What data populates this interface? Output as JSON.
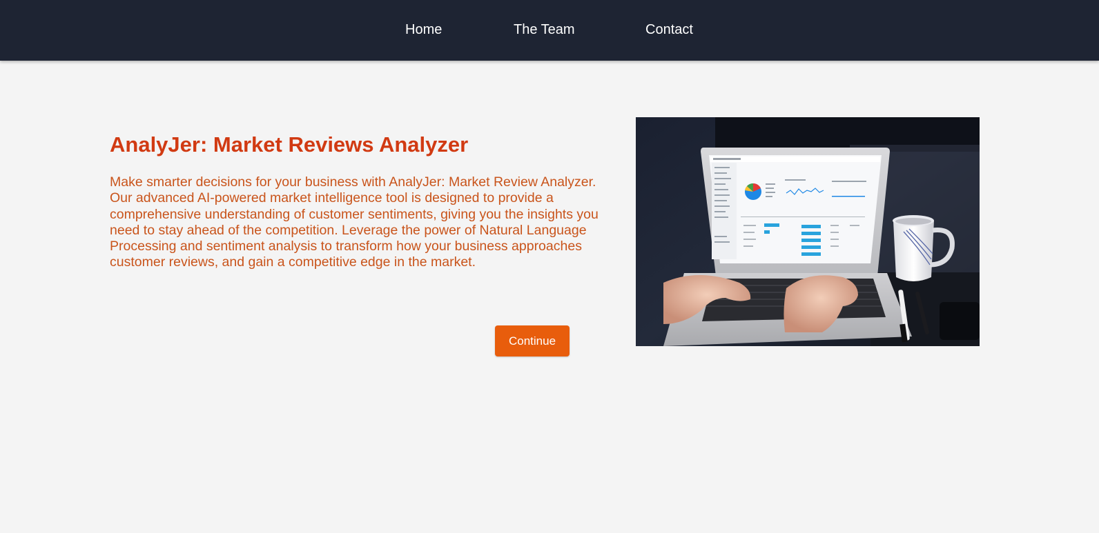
{
  "nav": {
    "items": [
      {
        "label": "Home"
      },
      {
        "label": "The Team"
      },
      {
        "label": "Contact"
      }
    ]
  },
  "hero": {
    "title": "AnalyJer: Market Reviews Analyzer",
    "description": "Make smarter decisions for your business with AnalyJer: Market Review Analyzer. Our advanced AI-powered market intelligence tool is designed to provide a comprehensive understanding of customer sentiments, giving you the insights you need to stay ahead of the competition. Leverage the power of Natural Language Processing and sentiment analysis to transform how your business approaches customer reviews, and gain a competitive edge in the market.",
    "button_label": "Continue",
    "image_icon": "laptop-analytics-photo"
  },
  "colors": {
    "navbar_bg": "#1e2433",
    "page_bg": "#f4f4f4",
    "title": "#d13a12",
    "description": "#c9541b",
    "button_bg": "#e85d0c"
  }
}
